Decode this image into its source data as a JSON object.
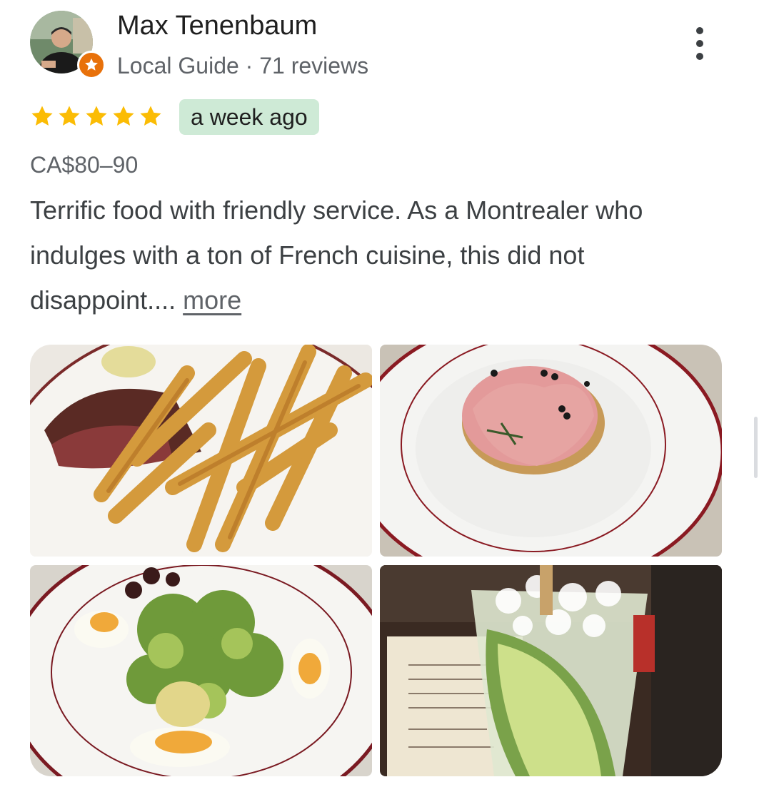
{
  "reviewer": {
    "name": "Max Tenenbaum",
    "role": "Local Guide",
    "separator": " · ",
    "reviews_count": "71 reviews"
  },
  "rating": {
    "stars": 5,
    "max": 5,
    "star_color": "#fbbc04"
  },
  "time_ago": "a week ago",
  "price": "CA$80–90",
  "review": {
    "text": "Terrific food with friendly service. As a Montrealer who indulges with a ton of French cuisine, this did not disappoint.... ",
    "more_label": "more"
  },
  "photos": [
    {
      "subject": "steak-frites-photo"
    },
    {
      "subject": "salmon-tartine-photo"
    },
    {
      "subject": "salad-with-eggs-photo"
    },
    {
      "subject": "cucumber-cocktail-photo"
    }
  ],
  "colors": {
    "chip_background": "#ceead6",
    "local_guide_badge": "#e8710a",
    "secondary_text": "#5f6368"
  }
}
